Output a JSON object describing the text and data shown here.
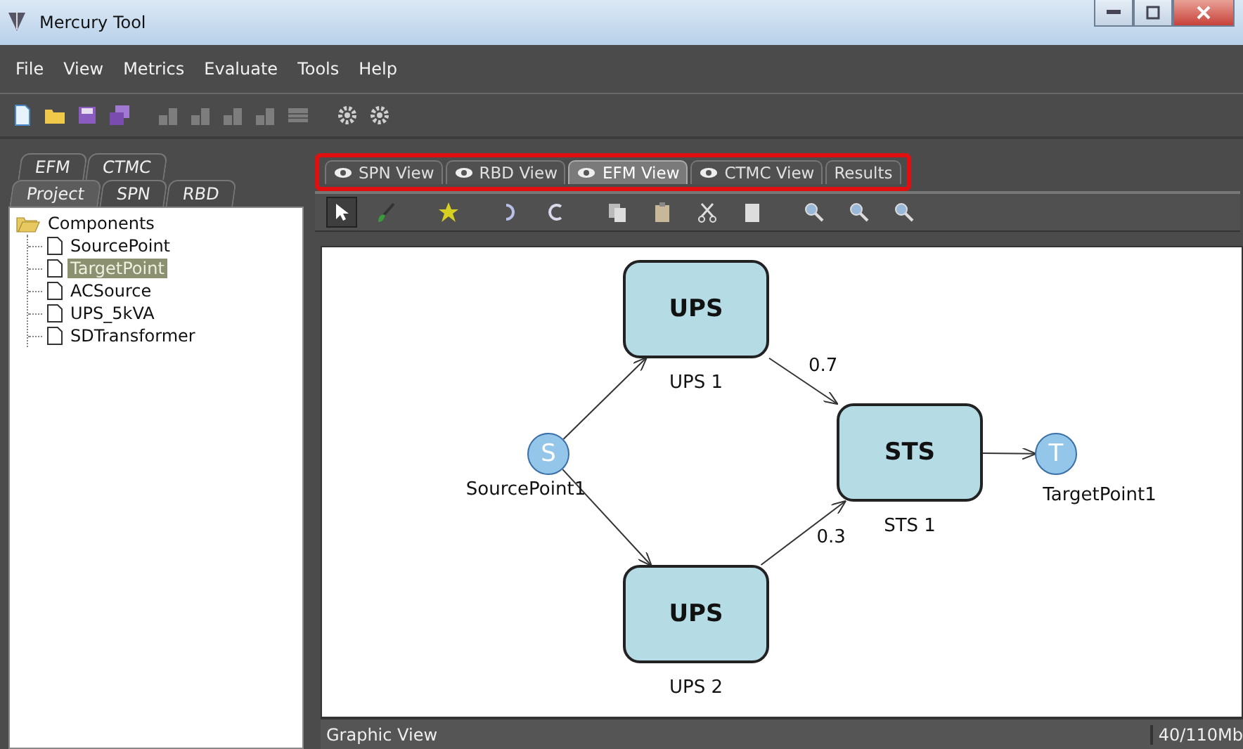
{
  "window": {
    "title": "Mercury Tool"
  },
  "menu": [
    "File",
    "View",
    "Metrics",
    "Evaluate",
    "Tools",
    "Help"
  ],
  "toolbar": [
    {
      "kind": "new",
      "disabled": false
    },
    {
      "kind": "open",
      "disabled": false
    },
    {
      "kind": "save",
      "disabled": false
    },
    {
      "kind": "saveall",
      "disabled": false
    },
    {
      "kind": "blocks",
      "disabled": true
    },
    {
      "kind": "blocks",
      "disabled": true
    },
    {
      "kind": "blocks",
      "disabled": true
    },
    {
      "kind": "blocks",
      "disabled": true
    },
    {
      "kind": "table",
      "disabled": true
    },
    {
      "kind": "gear",
      "disabled": false
    },
    {
      "kind": "gear",
      "disabled": false
    }
  ],
  "side_tabs": [
    [
      {
        "label": "EFM",
        "selected": false
      },
      {
        "label": "CTMC",
        "selected": false
      }
    ],
    [
      {
        "label": "Project",
        "selected": true
      },
      {
        "label": "SPN",
        "selected": false
      },
      {
        "label": "RBD",
        "selected": false
      }
    ]
  ],
  "tree": [
    {
      "label": "Components",
      "expanded": true,
      "selected": false,
      "children": [
        {
          "label": "SourcePoint",
          "selected": false
        },
        {
          "label": "TargetPoint",
          "selected": true
        },
        {
          "label": "ACSource",
          "selected": false
        },
        {
          "label": "UPS_5kVA",
          "selected": false
        },
        {
          "label": "SDTransformer",
          "selected": false
        }
      ]
    }
  ],
  "view_tabs_highlighted": true,
  "view_tabs": [
    {
      "label": "SPN View",
      "kind": "view",
      "selected": false
    },
    {
      "label": "RBD View",
      "kind": "view",
      "selected": false
    },
    {
      "label": "EFM View",
      "kind": "view",
      "selected": true
    },
    {
      "label": "CTMC View",
      "kind": "view",
      "selected": false
    },
    {
      "label": "Results",
      "kind": "results",
      "selected": false
    }
  ],
  "edit_toolbar": [
    {
      "kind": "pointer",
      "selected": true
    },
    {
      "kind": "brush",
      "selected": false
    },
    {
      "kind": "star",
      "selected": false
    },
    {
      "kind": "undo",
      "selected": false
    },
    {
      "kind": "redo",
      "selected": false
    },
    {
      "kind": "copy",
      "selected": false
    },
    {
      "kind": "paste",
      "selected": false
    },
    {
      "kind": "cut",
      "selected": false
    },
    {
      "kind": "delete",
      "selected": false
    },
    {
      "kind": "zoom",
      "selected": false
    },
    {
      "kind": "zoom",
      "selected": false
    },
    {
      "kind": "zoom",
      "selected": false
    }
  ],
  "diagram": {
    "nodes": [
      {
        "kind": "point",
        "letter": "S",
        "name": "SourcePoint1"
      },
      {
        "kind": "box",
        "title": "UPS",
        "name": "UPS 1"
      },
      {
        "kind": "box",
        "title": "UPS",
        "name": "UPS 2"
      },
      {
        "kind": "box",
        "title": "STS",
        "name": "STS 1"
      },
      {
        "kind": "point",
        "letter": "T",
        "name": "TargetPoint1"
      }
    ],
    "edge_labels": [
      "0.7",
      "0.3"
    ]
  },
  "status_bar": {
    "left": "Graphic View",
    "right": "40/110Mb"
  }
}
